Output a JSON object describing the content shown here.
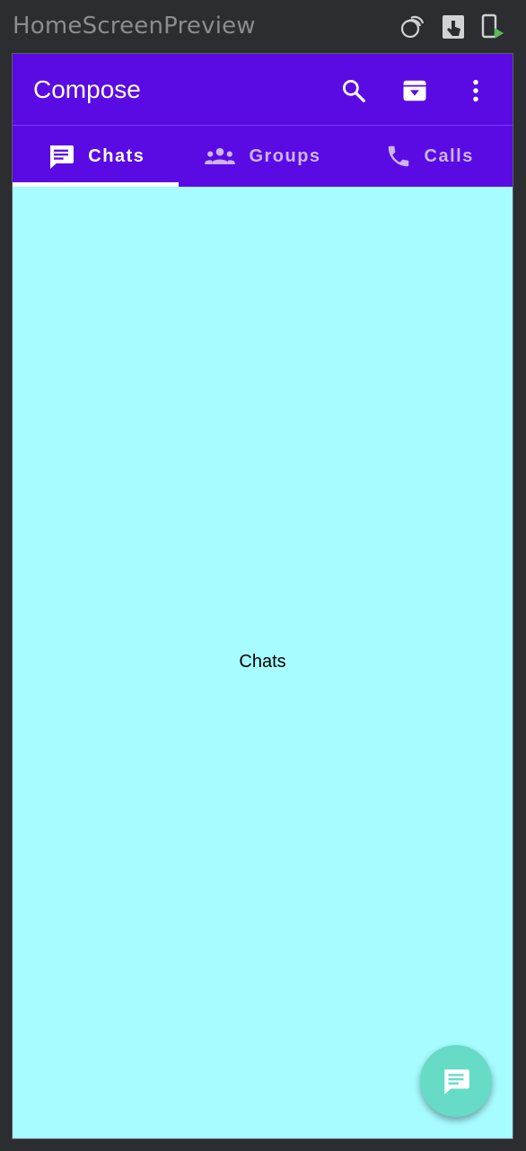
{
  "ide": {
    "title": "HomeScreenPreview",
    "icons": [
      "layers-icon",
      "interactive-mode-icon",
      "deploy-to-device-icon"
    ]
  },
  "app": {
    "title": "Compose",
    "colors": {
      "primary": "#5a0be3",
      "background": "#a6fcff",
      "fab": "#66dcc7",
      "on_primary": "#ffffff",
      "tab_inactive": "#cdb4f6"
    },
    "actions": [
      "search-icon",
      "archive-icon",
      "more-vert-icon"
    ],
    "tabs": [
      {
        "label": "Chats",
        "icon": "chat-icon",
        "selected": true
      },
      {
        "label": "Groups",
        "icon": "groups-icon",
        "selected": false
      },
      {
        "label": "Calls",
        "icon": "phone-icon",
        "selected": false
      }
    ],
    "content": {
      "text": "Chats"
    },
    "fab": {
      "icon": "new-message-icon"
    }
  }
}
